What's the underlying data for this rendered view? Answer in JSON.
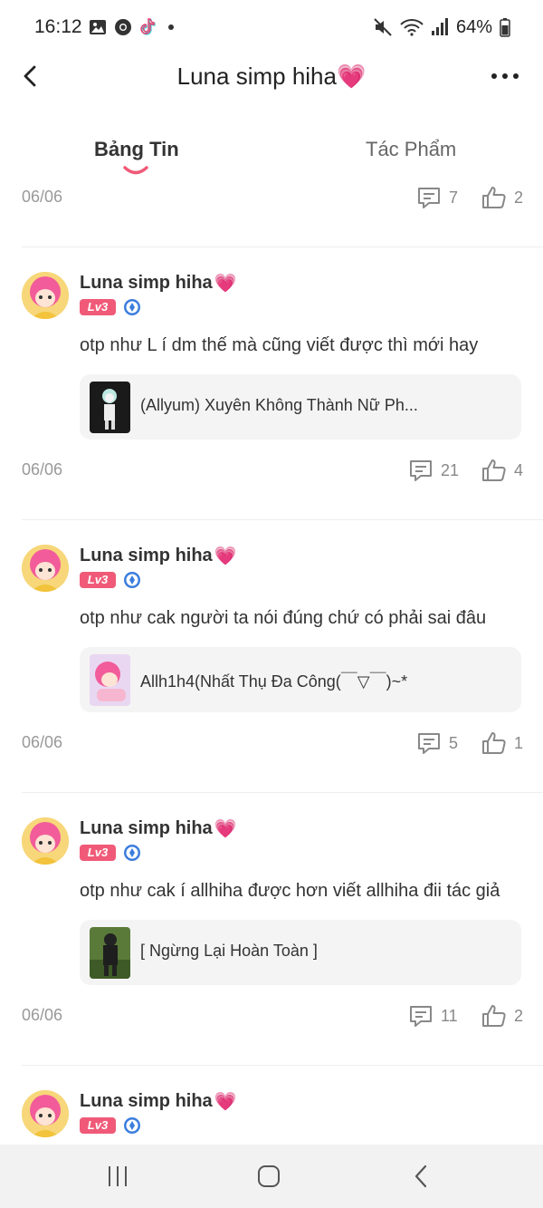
{
  "status_bar": {
    "time": "16:12",
    "battery": "64%",
    "left_icons": [
      "gallery-icon",
      "chrome-icon",
      "tiktok-icon",
      "dot-icon"
    ],
    "right_icons": [
      "mute-icon",
      "wifi-icon",
      "signal-icon",
      "battery-icon"
    ]
  },
  "header": {
    "title": "Luna simp hiha",
    "title_emoji": "💗",
    "back_icon": "chevron-left-icon",
    "more_icon": "more-horizontal-icon"
  },
  "tabs": [
    {
      "label": "Bảng Tin",
      "active": true
    },
    {
      "label": "Tác Phẩm",
      "active": false
    }
  ],
  "colors": {
    "accent": "#f05a78",
    "badge_blue": "#3b7ddd",
    "meta_gray": "#999999",
    "card_bg": "#f4f4f4"
  },
  "top_meta": {
    "date": "06/06",
    "comments": "7",
    "likes": "2"
  },
  "posts": [
    {
      "author": "Luna simp hiha",
      "emoji": "💗",
      "level": "Lv3",
      "text": "otp như L í dm thế mà cũng viết được thì mới hay",
      "work_title": "(Allyum) Xuyên Không Thành Nữ Ph...",
      "date": "06/06",
      "comments": "21",
      "likes": "4"
    },
    {
      "author": "Luna simp hiha",
      "emoji": "💗",
      "level": "Lv3",
      "text": "otp như cak người ta nói đúng chứ có phải sai đâu",
      "work_title": "Allh1h4(Nhất Thụ Đa Công(￣▽￣)~*",
      "date": "06/06",
      "comments": "5",
      "likes": "1"
    },
    {
      "author": "Luna simp hiha",
      "emoji": "💗",
      "level": "Lv3",
      "text": "otp như cak í allhiha được hơn viết allhiha đii tác giả",
      "work_title": "[ Ngừng Lại Hoàn Toàn ]",
      "date": "06/06",
      "comments": "11",
      "likes": "2"
    },
    {
      "author": "Luna simp hiha",
      "emoji": "💗",
      "level": "Lv3"
    }
  ],
  "nav_bar": {
    "recents_icon": "recent-apps-icon",
    "home_icon": "home-icon",
    "back_icon": "system-back-icon"
  }
}
